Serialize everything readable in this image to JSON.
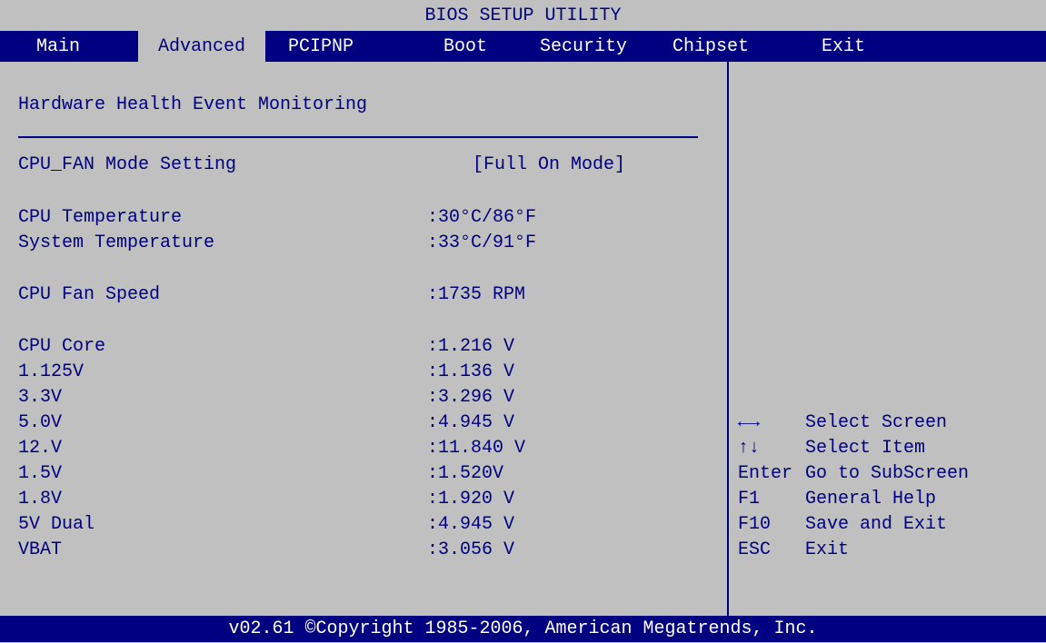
{
  "title": "BIOS SETUP UTILITY",
  "tabs": [
    {
      "label": "Main"
    },
    {
      "label": "Advanced"
    },
    {
      "label": "PCIPNP"
    },
    {
      "label": "Boot"
    },
    {
      "label": "Security"
    },
    {
      "label": "Chipset"
    },
    {
      "label": "Exit"
    }
  ],
  "active_tab": "Advanced",
  "section_title": "Hardware Health Event Monitoring",
  "fan_setting": {
    "label": "CPU_FAN Mode Setting",
    "value": "[Full On Mode]"
  },
  "readings": [
    {
      "label": "CPU Temperature",
      "value": ":30°C/86°F"
    },
    {
      "label": "System Temperature",
      "value": ":33°C/91°F"
    },
    {
      "label": "CPU Fan Speed",
      "value": ":1735 RPM"
    },
    {
      "label": "CPU Core",
      "value": ":1.216 V"
    },
    {
      "label": "1.125V",
      "value": ":1.136 V"
    },
    {
      "label": "3.3V",
      "value": ":3.296 V"
    },
    {
      "label": "5.0V",
      "value": ":4.945 V"
    },
    {
      "label": "12.V",
      "value": ":11.840 V"
    },
    {
      "label": "1.5V",
      "value": ":1.520V"
    },
    {
      "label": "1.8V",
      "value": ":1.920 V"
    },
    {
      "label": "5V Dual",
      "value": ":4.945 V"
    },
    {
      "label": "VBAT",
      "value": ":3.056 V"
    }
  ],
  "help": [
    {
      "key": "←→",
      "desc": "Select Screen"
    },
    {
      "key": "↑↓",
      "desc": "Select Item"
    },
    {
      "key": "Enter",
      "desc": "Go to SubScreen"
    },
    {
      "key": "F1",
      "desc": "General Help"
    },
    {
      "key": "F10",
      "desc": "Save and Exit"
    },
    {
      "key": "ESC",
      "desc": "Exit"
    }
  ],
  "footer": "v02.61 ©Copyright 1985-2006, American Megatrends, Inc.",
  "colors": {
    "background": "#c0c0c0",
    "accent": "#000080",
    "highlight_text": "#ffffff"
  }
}
